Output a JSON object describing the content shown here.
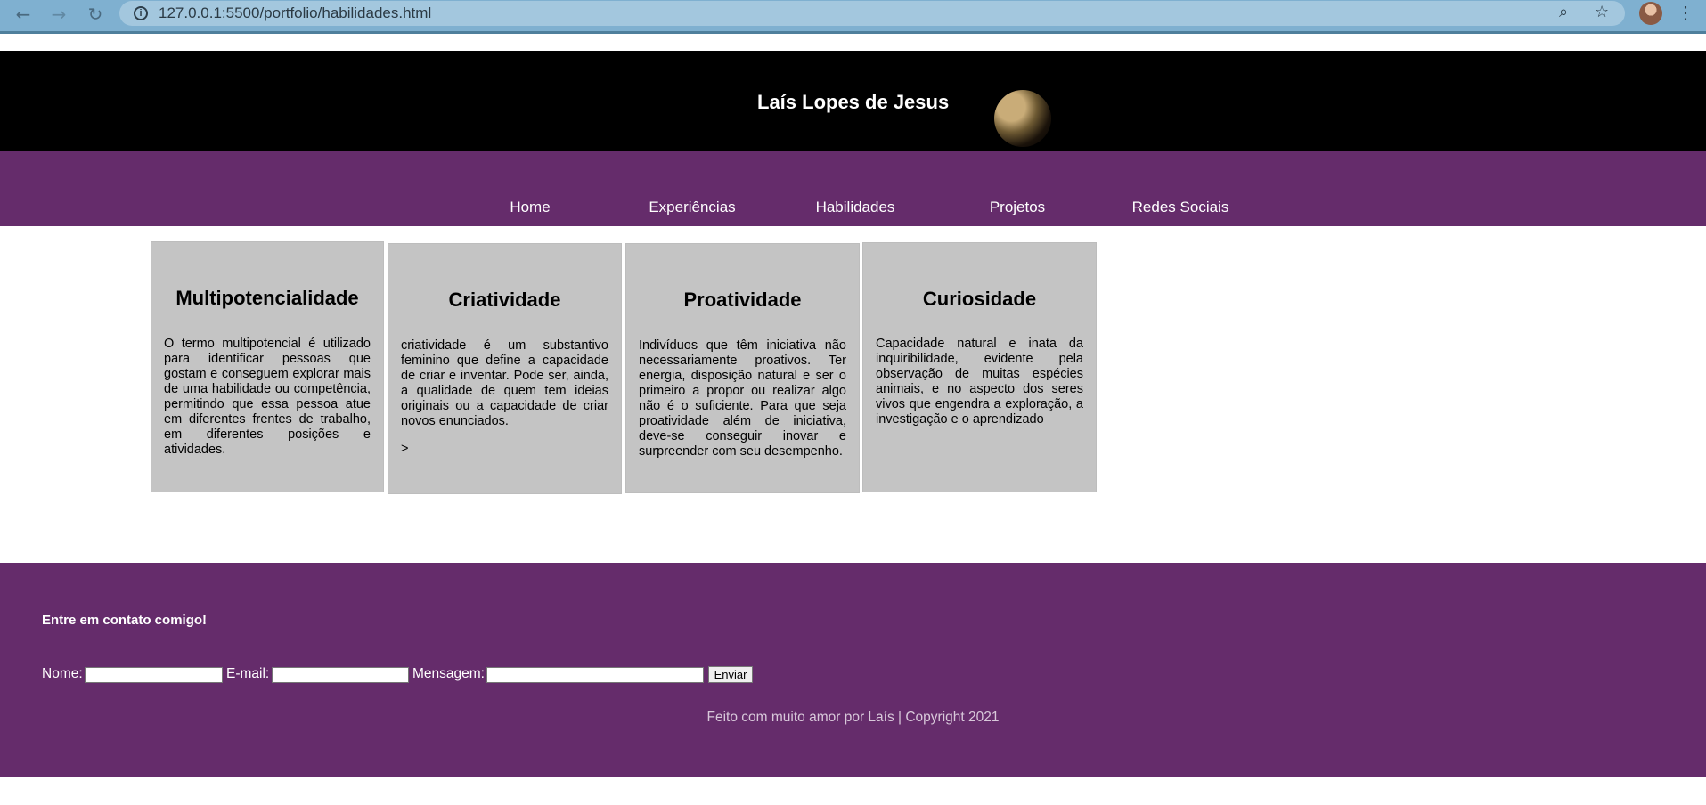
{
  "browser": {
    "url": "127.0.0.1:5500/portfolio/habilidades.html",
    "back_icon": "back-arrow-icon",
    "forward_icon": "forward-arrow-icon",
    "reload_icon": "reload-icon"
  },
  "header": {
    "title": "Laís Lopes de Jesus"
  },
  "nav": {
    "items": [
      "Home",
      "Experiências",
      "Habilidades",
      "Projetos",
      "Redes Sociais"
    ]
  },
  "cards": [
    {
      "title": "Multipotencialidade",
      "text": "O termo multipotencial é utilizado para identificar pessoas que gostam e conseguem explorar mais de uma habilidade ou competência, permitindo que essa pessoa atue em diferentes frentes de trabalho, em diferentes posições e atividades."
    },
    {
      "title": "Criatividade",
      "text": "criatividade é um substantivo feminino que define a capacidade de criar e inventar. Pode ser, ainda, a qualidade de quem tem ideias originais ou a capacidade de criar novos enunciados.",
      "extra": ">"
    },
    {
      "title": "Proatividade",
      "text": "Indivíduos que têm iniciativa não necessariamente proativos. Ter energia, disposição natural e ser o primeiro a propor ou realizar algo não é o suficiente. Para que seja proatividade além de iniciativa, deve-se conseguir inovar e surpreender com seu desempenho."
    },
    {
      "title": "Curiosidade",
      "text": "Capacidade natural e inata da inquiribilidade, evidente pela observação de muitas espécies animais, e no aspecto dos seres vivos que engendra a exploração, a investigação e o aprendizado"
    }
  ],
  "footer": {
    "contact_title": "Entre em contato comigo!",
    "name_label": "Nome:",
    "email_label": "E-mail:",
    "message_label": "Mensagem:",
    "send_label": "Enviar",
    "copyright": "Feito com muito amor por Laís | Copyright 2021"
  },
  "colors": {
    "header_bg": "#000000",
    "nav_bg": "#652c6b",
    "card_bg": "#c4c4c4",
    "chrome_bg": "#7fb0d0"
  }
}
